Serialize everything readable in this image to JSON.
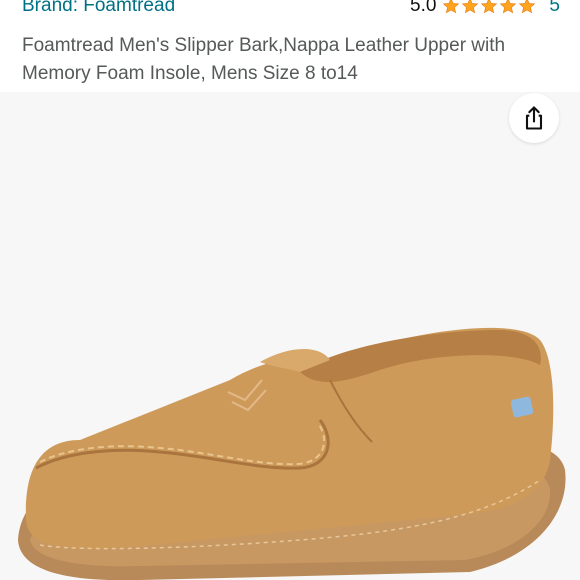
{
  "header": {
    "brand_label": "Brand: Foamtread",
    "rating_value": "5.0",
    "rating_count": "5",
    "stars": 5
  },
  "product": {
    "title": "Foamtread Men's Slipper Bark,Nappa Leather Upper with Memory Foam Insole, Mens Size 8 to14"
  },
  "icons": {
    "share": "share-icon",
    "star": "star-icon"
  },
  "colors": {
    "link": "#007185",
    "star": "#FFA41C",
    "text": "#565959",
    "image_bg": "#f7f7f7",
    "leather": "#CE9A5A",
    "sole": "#B98A59"
  }
}
